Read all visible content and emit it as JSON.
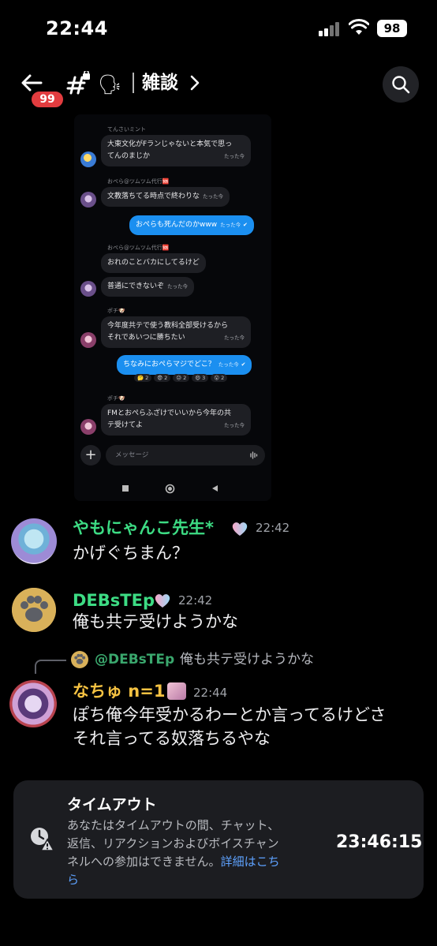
{
  "status_bar": {
    "time": "22:44",
    "battery": "98"
  },
  "header": {
    "unread_count": "99",
    "channel_emoji": "🗣",
    "channel_name": "雑談"
  },
  "embedded_screenshot": {
    "messages": [
      {
        "name": "てんさいミント",
        "text": [
          "大東文化がFランじゃないと本気で思っ",
          "てんのまじか"
        ],
        "time": "たった今"
      },
      {
        "name": "おぺら@ツムツム代行🆘",
        "text": [
          "文教落ちてる時点で終わりな"
        ],
        "time": "たった今"
      },
      {
        "name": "",
        "text": [
          "おぺらも死んだのかwww"
        ],
        "time": "たった今",
        "self": true
      },
      {
        "name": "おぺら@ツムツム代行🆘",
        "text": [
          "おれのことバカにしてるけど"
        ],
        "time": ""
      },
      {
        "name": "",
        "text": [
          "普通にできないぞ"
        ],
        "time": "たった今"
      },
      {
        "name": "ポチ🐶",
        "text": [
          "今年度共テで使う教科全部受けるから",
          "それであいつに勝ちたい"
        ],
        "time": "たった今"
      },
      {
        "name": "",
        "text": [
          "ちなみにおぺらマジでどこ？"
        ],
        "time": "たった今",
        "self": true
      },
      {
        "name": "ポチ🐶",
        "text": [
          "FMとおぺらふざけでいいから今年の共",
          "テ受けてよ"
        ],
        "time": "たった今"
      }
    ],
    "reactions": [
      "🤔 2",
      "😨 2",
      "😥 2",
      "😄 3",
      "😮 2"
    ],
    "input_placeholder": "メッセージ"
  },
  "messages": [
    {
      "author": "やもにゃんこ先生*",
      "author_color": "#3ddc84",
      "time": "22:42",
      "content": [
        "かげぐちまん？"
      ]
    },
    {
      "author": "DEBsTEp",
      "author_color": "#3ddc84",
      "time": "22:42",
      "content": [
        "俺も共テ受けようかな"
      ]
    },
    {
      "author": "なちゅ n=1",
      "author_color": "#f5c242",
      "time": "22:44",
      "content": [
        "ぽち俺今年受かるわーとか言ってるけどさ",
        "それ言ってる奴落ちるやな"
      ],
      "reply": {
        "author": "@DEBsTEp",
        "text": "俺も共テ受けようかな"
      }
    }
  ],
  "timeout": {
    "title": "タイムアウト",
    "description_lines": [
      "あなたはタイムアウトの間、チャット、",
      "返信、リアクションおよびボイスチャン",
      "ネルへの参加はできません。"
    ],
    "link_label_1": "詳細はこち",
    "link_label_2": "ら",
    "timer": "23:46:15"
  },
  "colors": {
    "accent_blue": "#1b8ff0",
    "badge_red": "#e23c3f",
    "link": "#5ea2ff"
  }
}
